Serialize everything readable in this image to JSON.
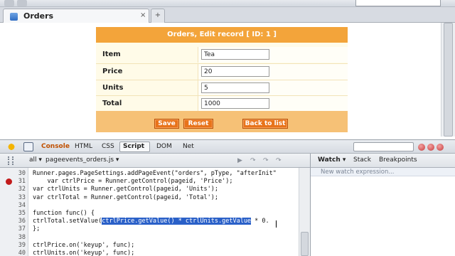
{
  "browser": {
    "tab_title": "Orders",
    "tab_close": "×",
    "new_tab": "+"
  },
  "form": {
    "title": "Orders, Edit record [ ID: 1 ]",
    "fields": [
      {
        "label": "Item",
        "value": "Tea"
      },
      {
        "label": "Price",
        "value": "20"
      },
      {
        "label": "Units",
        "value": "5"
      },
      {
        "label": "Total",
        "value": "1000"
      }
    ],
    "buttons": {
      "save": "Save",
      "reset": "Reset",
      "back": "Back to list"
    }
  },
  "firebug": {
    "tabs": {
      "console": "Console",
      "html": "HTML",
      "css": "CSS",
      "script": "Script ▾",
      "dom": "DOM",
      "net": "Net"
    },
    "script_scope": "all ▾",
    "script_file": "pageevents_orders.js ▾",
    "side_tabs": {
      "watch": "Watch ▾",
      "stack": "Stack",
      "breakpoints": "Breakpoints"
    },
    "watch_placeholder": "New watch expression...",
    "code_lines": [
      {
        "n": "30",
        "text": "Runner.pages.PageSettings.addPageEvent(\"orders\", pType, \"afterInit\"",
        "bp": false
      },
      {
        "n": "31",
        "text": "    var ctrlPrice = Runner.getControl(pageid, 'Price');",
        "bp": true
      },
      {
        "n": "32",
        "text": "var ctrlUnits = Runner.getControl(pageid, 'Units');",
        "bp": false
      },
      {
        "n": "33",
        "text": "var ctrlTotal = Runner.getControl(pageid, 'Total');",
        "bp": false
      },
      {
        "n": "34",
        "text": "",
        "bp": false
      },
      {
        "n": "35",
        "text": "function func() {",
        "bp": false
      },
      {
        "n": "36",
        "pre": "ctrlTotal.setValue(",
        "hl": "ctrlPrice.getValue() * ctrlUnits.getValue",
        "post": " * 0.",
        "bp": false
      },
      {
        "n": "37",
        "text": "};",
        "bp": false
      },
      {
        "n": "38",
        "text": "",
        "bp": false
      },
      {
        "n": "39",
        "text": "ctrlPrice.on('keyup', func);",
        "bp": false
      },
      {
        "n": "40",
        "text": "ctrlUnits.on('keyup', func);",
        "bp": false
      }
    ]
  }
}
